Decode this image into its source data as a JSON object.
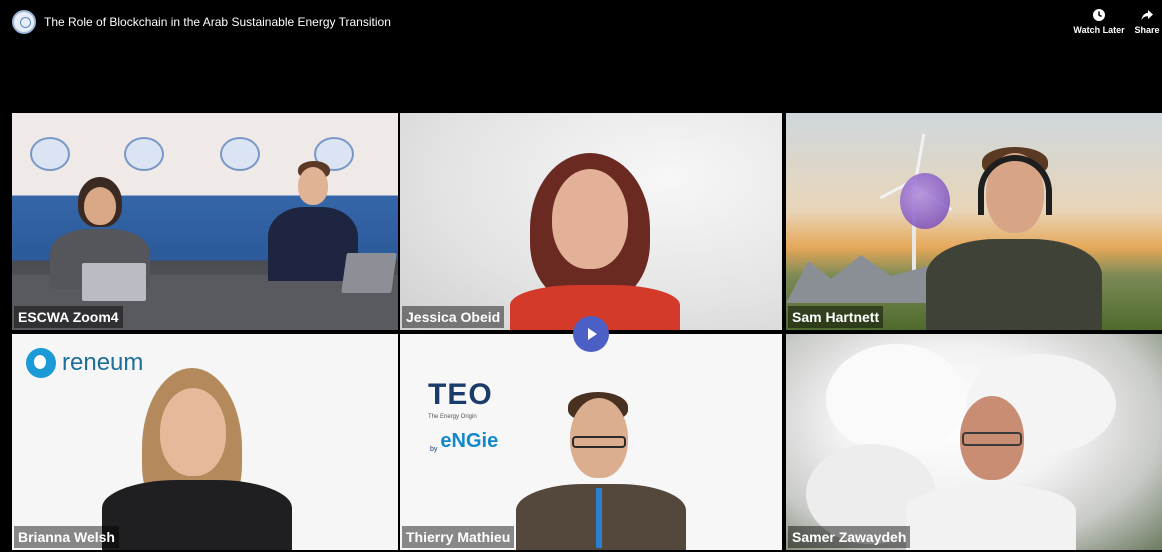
{
  "header": {
    "title": "The Role of Blockchain in the Arab Sustainable Energy Transition",
    "watch_later_label": "Watch Later",
    "share_label": "Share"
  },
  "participants": [
    {
      "name": "ESCWA Zoom4",
      "active": true
    },
    {
      "name": "Jessica Obeid",
      "active": false
    },
    {
      "name": "Sam Hartnett",
      "active": false
    },
    {
      "name": "Brianna Welsh",
      "active": false
    },
    {
      "name": "Thierry Mathieu",
      "active": false
    },
    {
      "name": "Samer Zawaydeh",
      "active": false
    }
  ],
  "logos": {
    "reneum": "reneum",
    "teo": "TEO",
    "teo_sub": "The Energy Origin",
    "engie_by": "by",
    "engie": "eNGie"
  },
  "colors": {
    "active_speaker_border": "#6fd43a",
    "play_button": "#4b5fc4"
  }
}
